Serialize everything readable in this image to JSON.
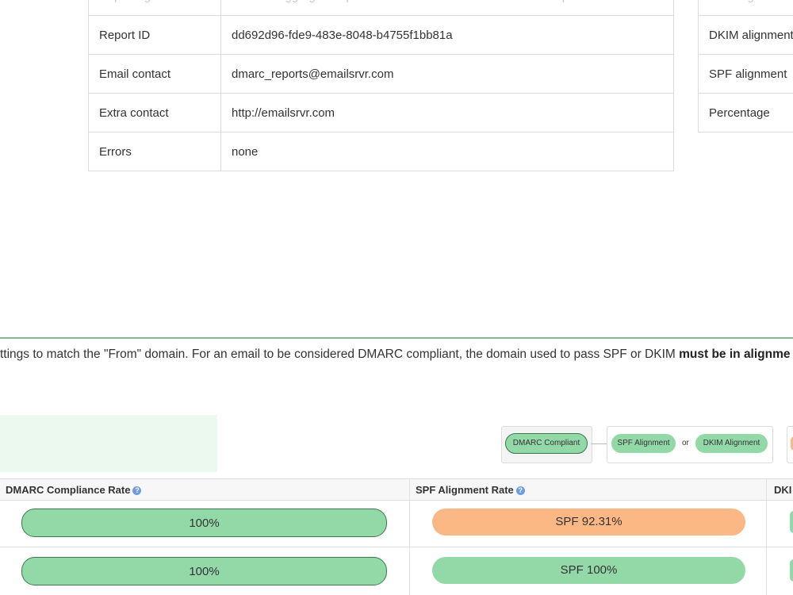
{
  "report_table": {
    "rows": [
      {
        "key": "Reporting",
        "value": "DMARC aggregate report from emailsrvr.com for domain example.com"
      },
      {
        "key": "Report ID",
        "value": "dd692d96-fde9-483e-8048-b4755f1bb81a"
      },
      {
        "key": "Email contact",
        "value": "dmarc_reports@emailsrvr.com"
      },
      {
        "key": "Extra contact",
        "value": "http://emailsrvr.com"
      },
      {
        "key": "Errors",
        "value": "none"
      }
    ]
  },
  "policy_table": {
    "rows": [
      "SPF alignment",
      "DKIM alignment",
      "SPF alignment",
      "Percentage"
    ]
  },
  "explanation": {
    "text": "ttings to match the \"From\" domain. For an email to be considered DMARC compliant, the domain used to pass SPF or DKIM ",
    "bold": "must be in alignme"
  },
  "legend": {
    "dmarc": "DMARC Compliant",
    "spf": "SPF Alignment",
    "or": "or",
    "dkim": "DKIM Alignment"
  },
  "compliance": {
    "headers": [
      "DMARC Compliance Rate",
      "SPF Alignment Rate",
      "DKI"
    ],
    "help_icon": "?",
    "rows": [
      {
        "dmarc": "100%",
        "spf": "SPF 92.31%",
        "spf_status": "warning"
      },
      {
        "dmarc": "100%",
        "spf": "SPF 100%",
        "spf_status": "ok"
      }
    ]
  },
  "colors": {
    "pass_green": "#93d9a8",
    "warning_orange": "#fbb884",
    "section_rule": "#7fb993"
  }
}
